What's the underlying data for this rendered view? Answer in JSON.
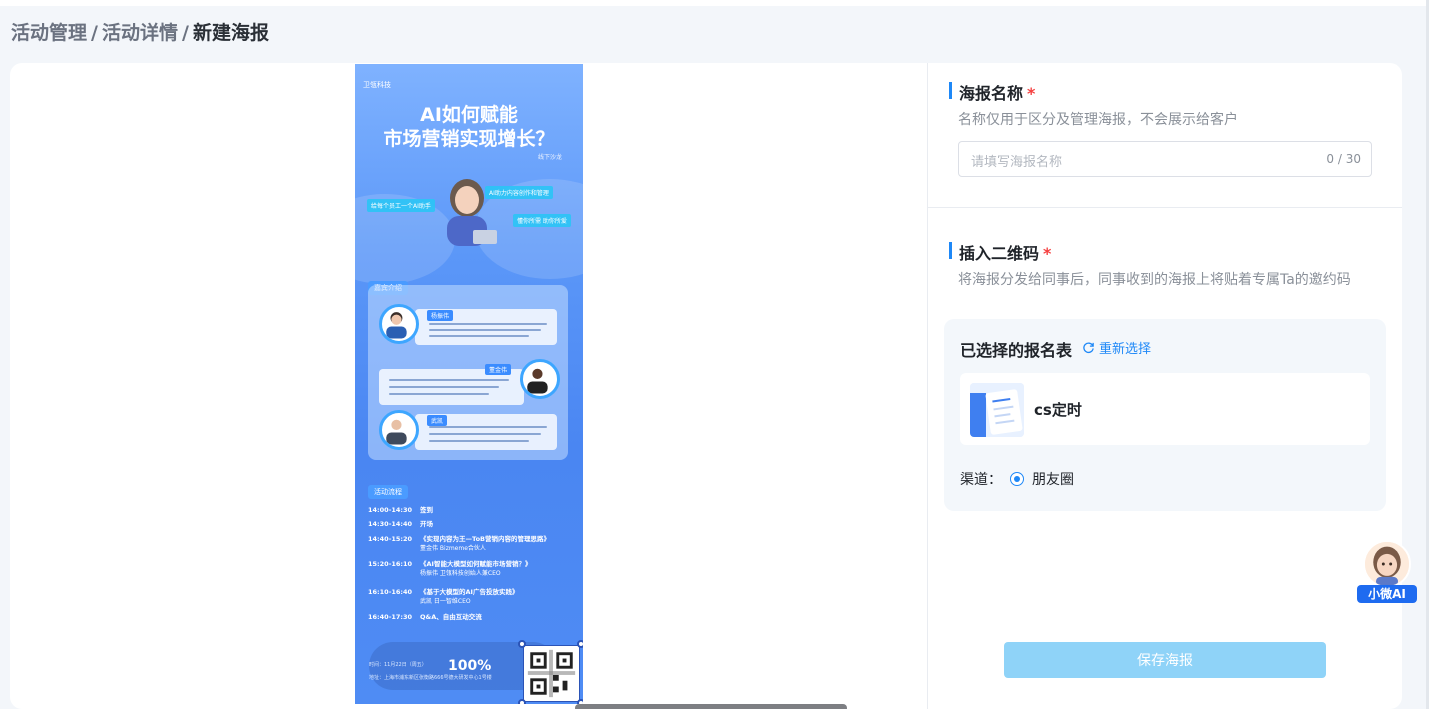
{
  "breadcrumb": {
    "items": [
      "活动管理",
      "活动详情"
    ],
    "current": "新建海报",
    "separator": "/"
  },
  "poster": {
    "brand": "卫瓴科技",
    "title_line1": "AI如何赋能",
    "title_line2": "市场营销实现增长？",
    "signature": "线下沙龙",
    "tags": [
      "给每个员工一个AI助手",
      "AI助力内容创作和管理",
      "懂你所需 助你所爱"
    ],
    "section_guests": "嘉宾介绍",
    "guests": [
      {
        "name": "杨振伟"
      },
      {
        "name": "董金伟"
      },
      {
        "name": "武凯"
      }
    ],
    "section_schedule": "活动流程",
    "schedule": [
      {
        "time": "14:00-14:30",
        "item": "签到",
        "sub": ""
      },
      {
        "time": "14:30-14:40",
        "item": "开场",
        "sub": ""
      },
      {
        "time": "14:40-15:20",
        "item": "《实现内容为王—ToB营销内容的管理思路》",
        "sub": "董金伟 Bizmeme合伙人"
      },
      {
        "time": "15:20-16:10",
        "item": "《AI智能大模型如何赋能市场营销？》",
        "sub": "杨振伟 卫瓴科技创始人兼CEO"
      },
      {
        "time": "16:10-16:40",
        "item": "《基于大模型的AI广告投放实践》",
        "sub": "武凯 日一智维CEO"
      },
      {
        "time": "16:40-17:30",
        "item": "Q&A、自由互动交流",
        "sub": ""
      }
    ],
    "info_time": "时间：11月22日（周五）",
    "info_address": "地址：上海市浦东新区张衡路666号德大研发中心1号楼",
    "zoom": "100%"
  },
  "form": {
    "poster_name_label": "海报名称",
    "required_mark": "*",
    "poster_name_hint": "名称仅用于区分及管理海报，不会展示给客户",
    "poster_name_placeholder": "请填写海报名称",
    "poster_name_count": "0 / 30",
    "qr_label": "插入二维码",
    "qr_hint": "将海报分发给同事后，同事收到的海报上将贴着专属Ta的邀约码",
    "selected_title": "已选择的报名表",
    "reselect": "重新选择",
    "selected_form_name": "cs定时",
    "channel_label": "渠道：",
    "channel_value": "朋友圈",
    "save_button": "保存海报"
  },
  "assistant": {
    "label": "小微AI"
  },
  "colors": {
    "accent": "#1e88f7",
    "required": "#f53f3f",
    "save_disabled": "#8fd3f8"
  }
}
